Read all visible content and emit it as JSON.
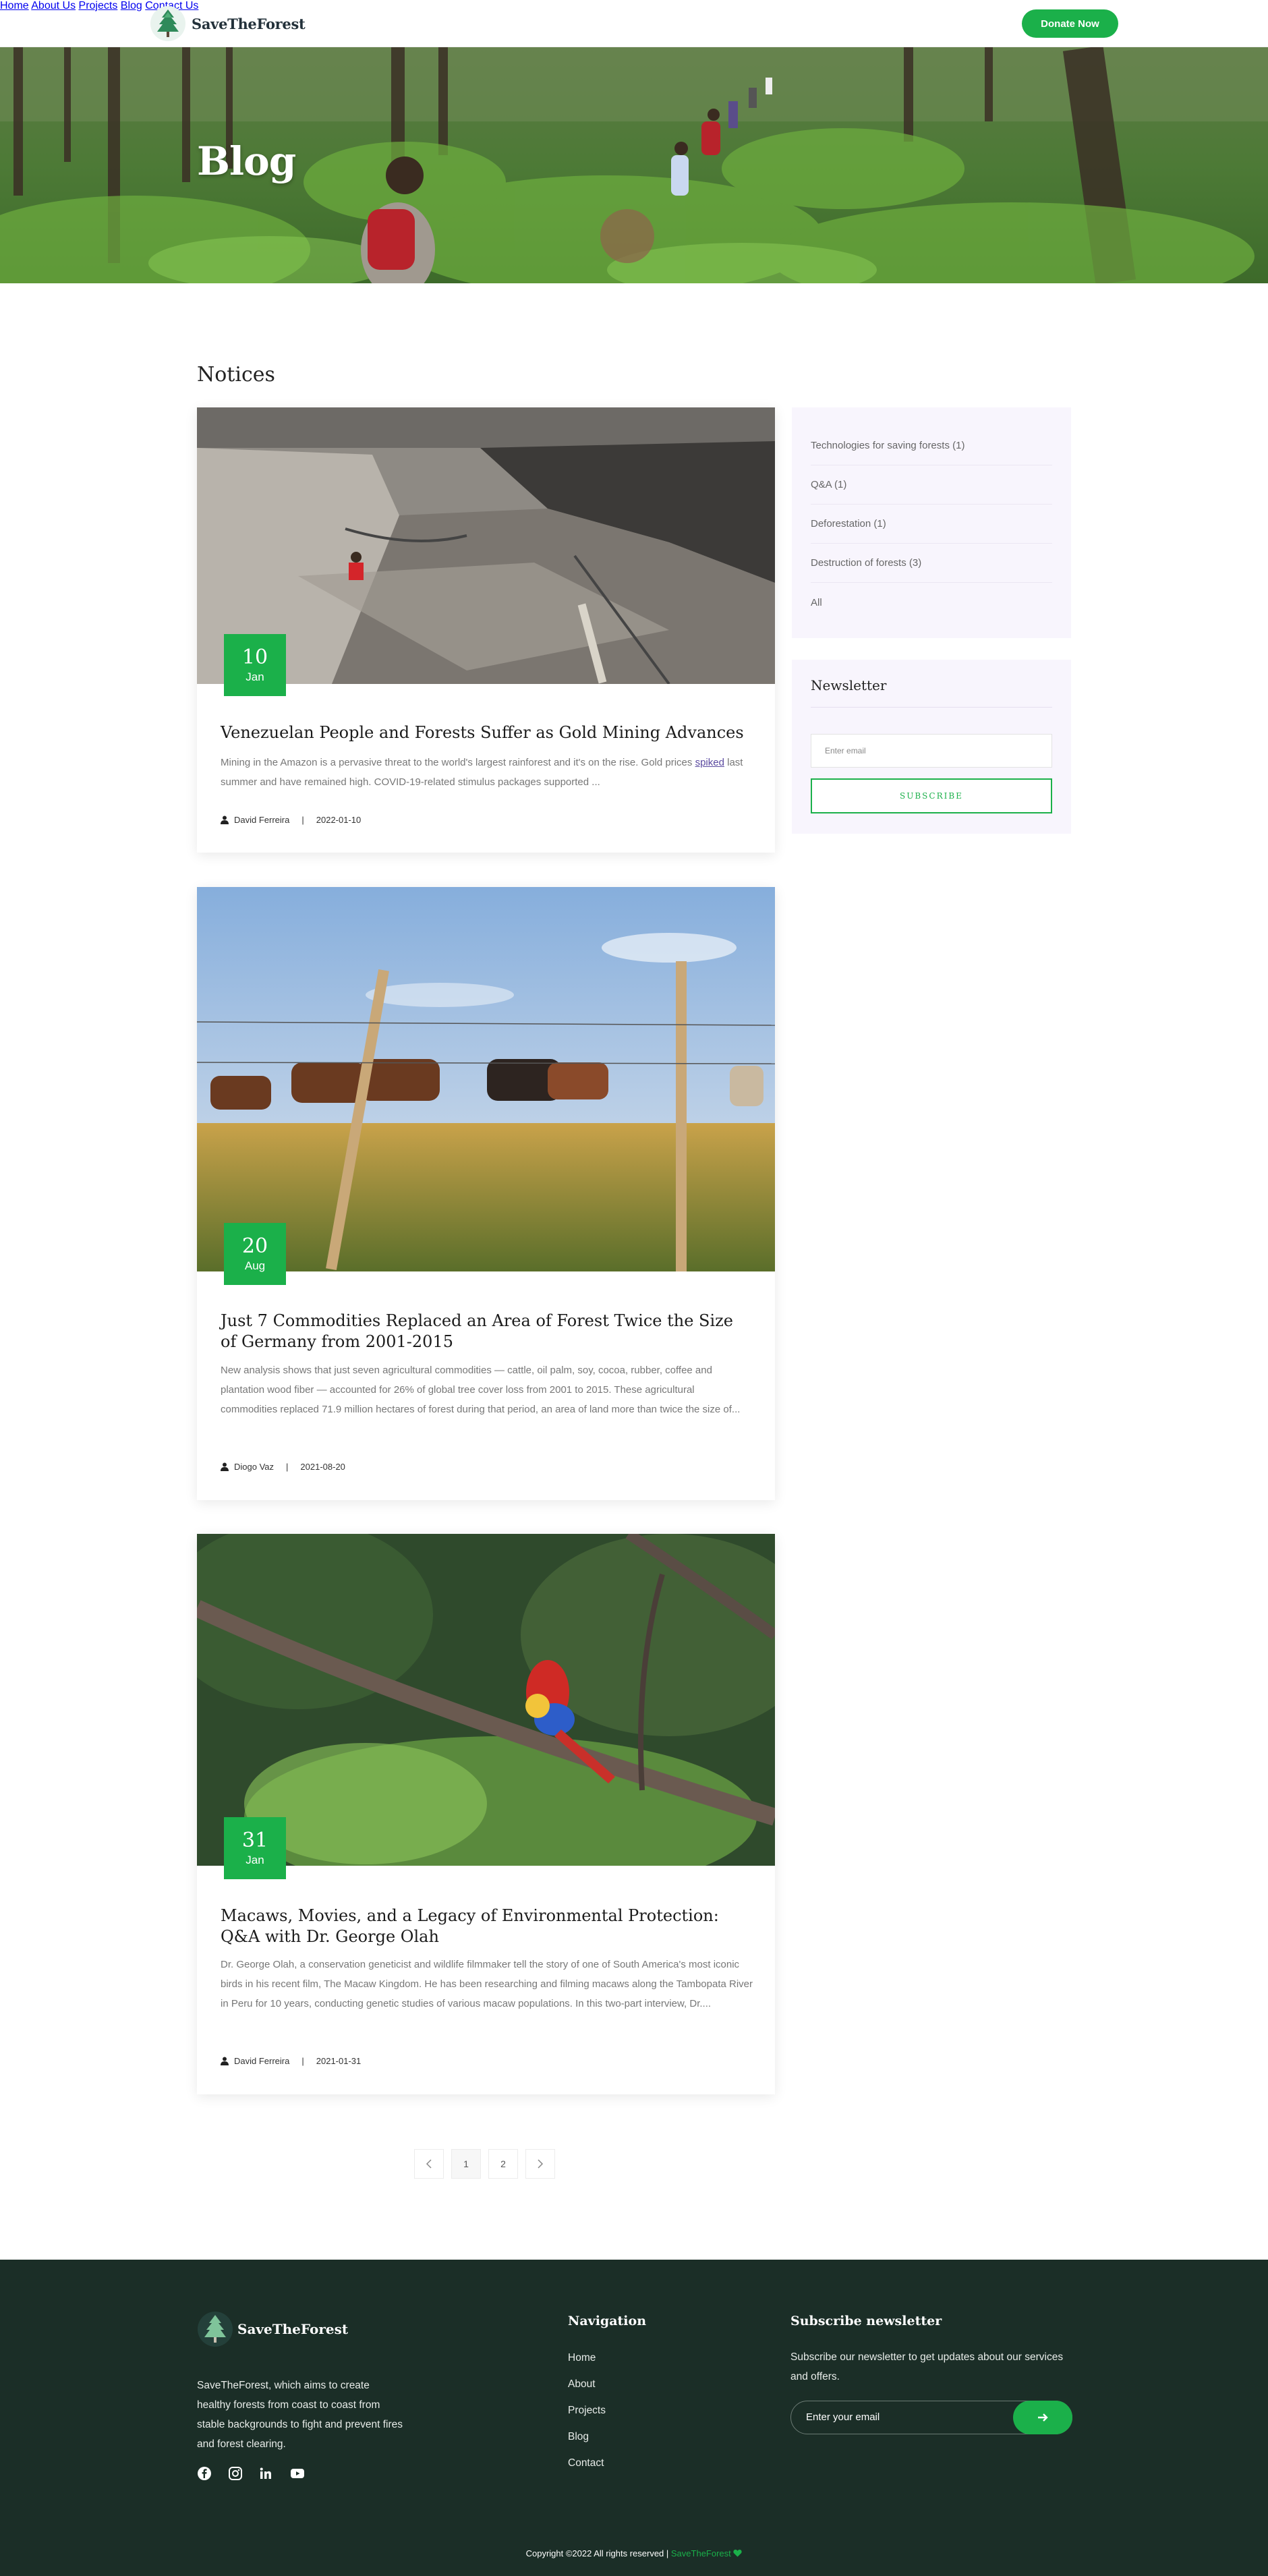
{
  "header": {
    "brand": "SaveTheForest",
    "nav": [
      "Home",
      "About Us",
      "Projects",
      "Blog",
      "Contact Us"
    ],
    "donate": "Donate Now"
  },
  "hero": {
    "title": "Blog"
  },
  "main": {
    "section_title": "Notices"
  },
  "posts": [
    {
      "day": "10",
      "month": "Jan",
      "title": "Venezuelan People and Forests Suffer as Gold Mining Advances",
      "excerpt_before": "Mining in the Amazon is a pervasive threat to the world's largest rainforest and it's on the rise. Gold prices ",
      "excerpt_link": "spiked",
      "excerpt_after": " last summer and have remained high. COVID-19-related stimulus packages supported ...",
      "author": "David Ferreira",
      "date": "2022-01-10"
    },
    {
      "day": "20",
      "month": "Aug",
      "title": "Just 7 Commodities Replaced an Area of Forest Twice the Size of Germany from 2001-2015",
      "excerpt": "New analysis shows that just seven agricultural commodities — cattle, oil palm, soy, cocoa, rubber, coffee and plantation wood fiber — accounted for 26% of global tree cover loss from 2001 to 2015. These agricultural commodities replaced 71.9 million hectares of forest during that period, an area of land more than twice the size of...",
      "author": "Diogo Vaz",
      "date": "2021-08-20"
    },
    {
      "day": "31",
      "month": "Jan",
      "title": "Macaws, Movies, and a Legacy of Environmental Protection: Q&A with Dr. George Olah",
      "excerpt": "Dr. George Olah, a conservation geneticist and wildlife filmmaker tell the story of one of South America's most iconic birds in his recent film, The Macaw Kingdom. He has been researching and filming macaws along the Tambopata River in Peru for 10 years, conducting genetic studies of various macaw populations. In this two-part interview, Dr....",
      "author": "David Ferreira",
      "date": "2021-01-31"
    }
  ],
  "sidebar": {
    "categories": [
      "Technologies for saving forests (1)",
      "Q&A (1)",
      "Deforestation (1)",
      "Destruction of forests (3)",
      "All"
    ],
    "newsletter_title": "Newsletter",
    "email_placeholder": "Enter email",
    "subscribe": "SUBSCRIBE"
  },
  "pagination": {
    "prev": "‹",
    "pages": [
      "1",
      "2"
    ],
    "next": "›"
  },
  "footer": {
    "brand": "SaveTheForest",
    "about": "SaveTheForest, which aims to create healthy forests from coast to coast from stable backgrounds to fight and prevent fires and forest clearing.",
    "nav_title": "Navigation",
    "nav": [
      "Home",
      "About",
      "Projects",
      "Blog",
      "Contact"
    ],
    "subscribe_title": "Subscribe newsletter",
    "subscribe_text": "Subscribe our newsletter to get updates about our services and offers.",
    "email_placeholder": "Enter your email",
    "copyright": "Copyright ©2022 All rights reserved | ",
    "copyright_brand": "SaveTheForest"
  },
  "colors": {
    "accent": "#1bb04a",
    "footer_bg": "#1b2e27",
    "sidebar_bg": "#f8f5fd"
  },
  "icons": [
    "tree-logo-icon",
    "user-icon",
    "chevron-left-icon",
    "chevron-right-icon",
    "facebook-icon",
    "instagram-icon",
    "linkedin-icon",
    "youtube-icon",
    "arrow-right-icon",
    "heart-icon"
  ]
}
